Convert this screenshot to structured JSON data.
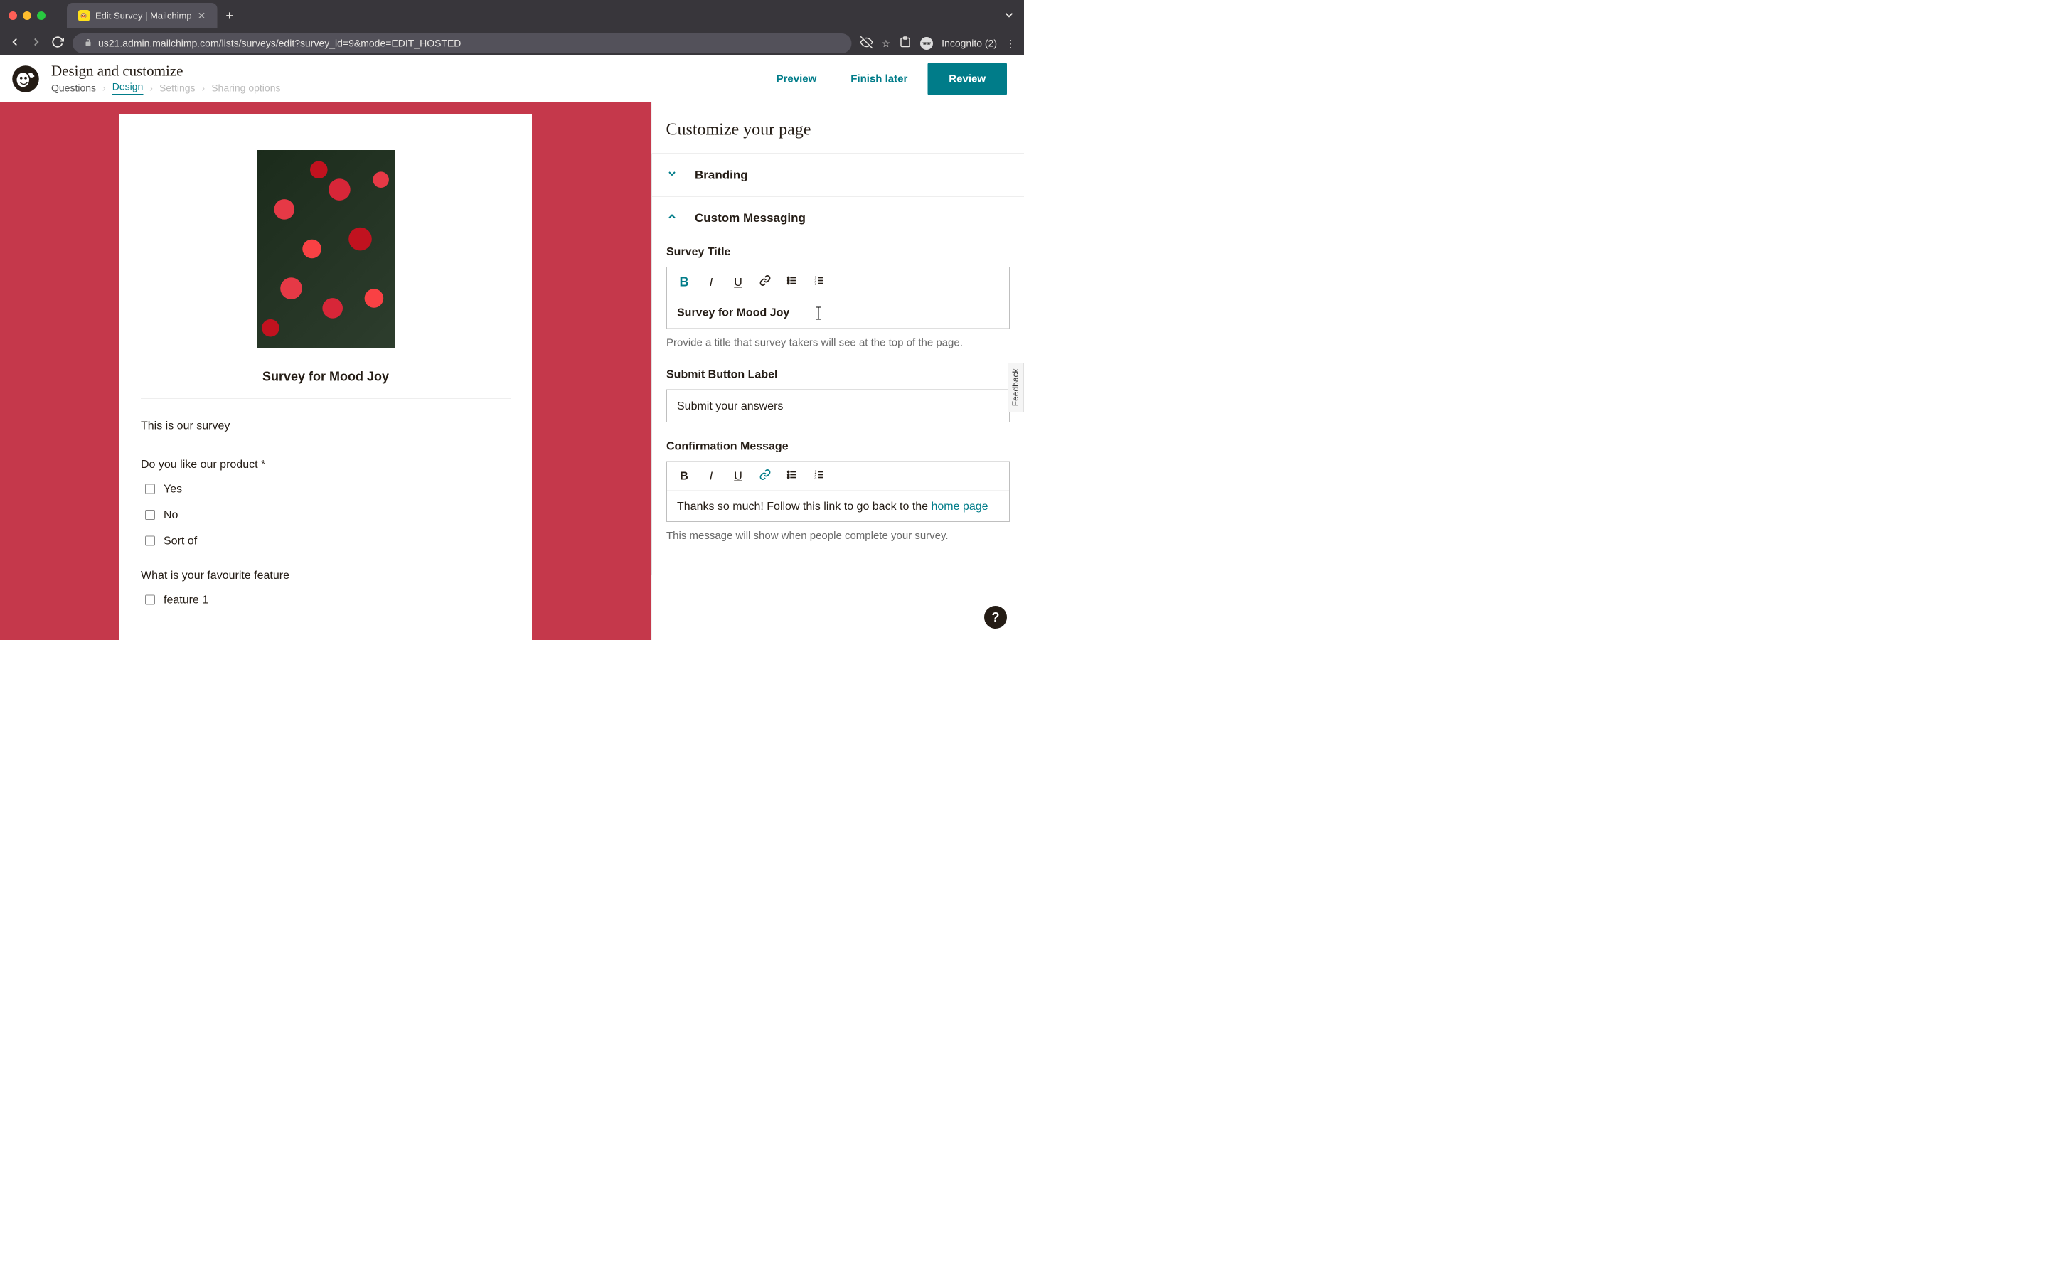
{
  "browser": {
    "tab_title": "Edit Survey | Mailchimp",
    "url": "us21.admin.mailchimp.com/lists/surveys/edit?survey_id=9&mode=EDIT_HOSTED",
    "incognito_label": "Incognito (2)"
  },
  "header": {
    "title": "Design and customize",
    "breadcrumbs": [
      "Questions",
      "Design",
      "Settings",
      "Sharing options"
    ],
    "active_crumb_index": 1,
    "actions": {
      "preview": "Preview",
      "finish_later": "Finish later",
      "review": "Review"
    }
  },
  "preview": {
    "background_color": "#c5384b",
    "survey_title": "Survey for Mood Joy",
    "intro_text": "This is our survey",
    "questions": [
      {
        "text": "Do you like our product *",
        "options": [
          "Yes",
          "No",
          "Sort of"
        ]
      },
      {
        "text": "What is your favourite feature",
        "options": [
          "feature 1"
        ]
      }
    ]
  },
  "sidebar": {
    "heading": "Customize your page",
    "sections": {
      "branding": {
        "title": "Branding",
        "expanded": false
      },
      "custom_messaging": {
        "title": "Custom Messaging",
        "expanded": true
      }
    },
    "survey_title": {
      "label": "Survey Title",
      "value": "Survey for Mood Joy",
      "helper": "Provide a title that survey takers will see at the top of the page."
    },
    "submit_button": {
      "label": "Submit Button Label",
      "value": "Submit your answers"
    },
    "confirmation": {
      "label": "Confirmation Message",
      "value_prefix": "Thanks so much! Follow this link to go back to the ",
      "value_link": "home page",
      "helper": "This message will show when people complete your survey."
    },
    "feedback_tab": "Feedback"
  },
  "help_fab": "?"
}
